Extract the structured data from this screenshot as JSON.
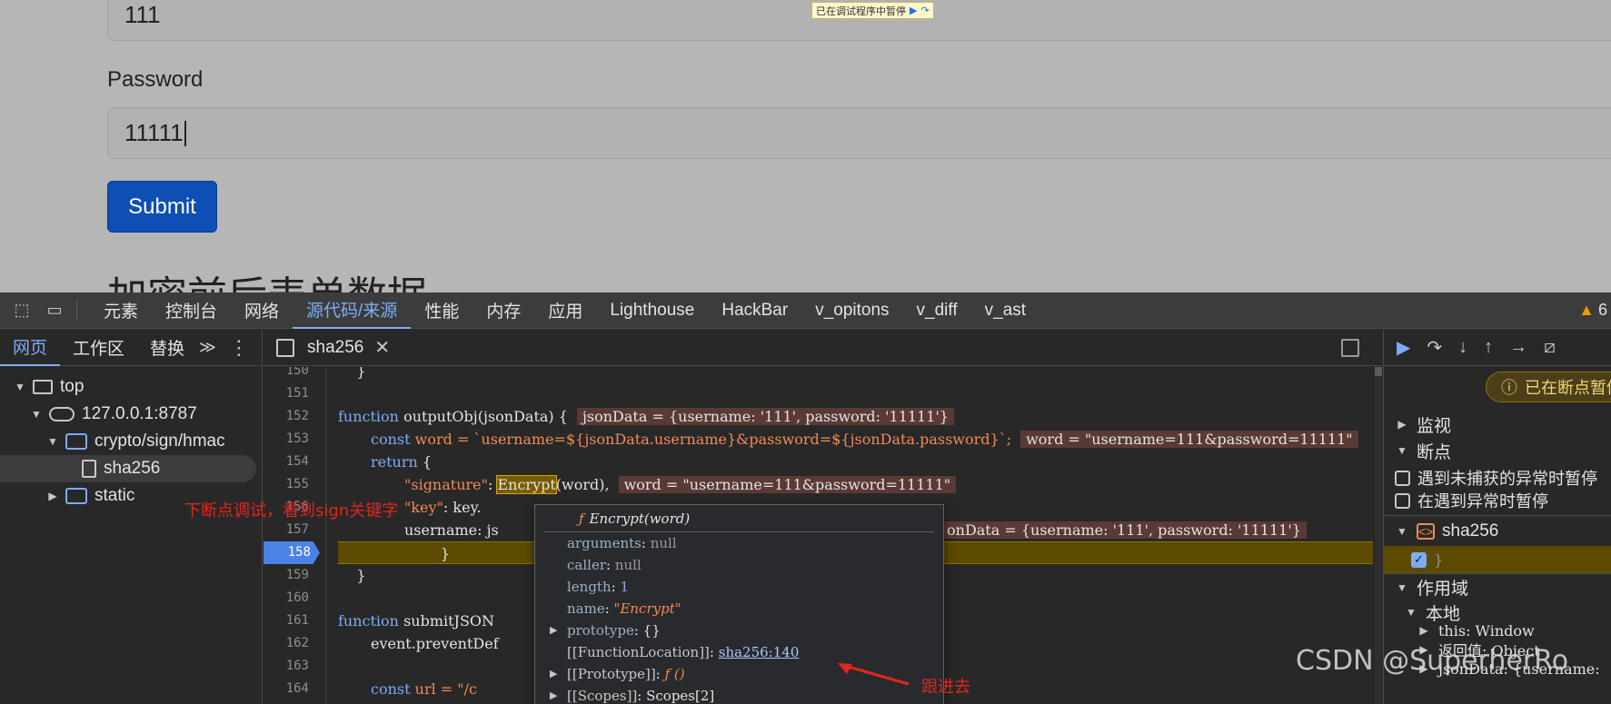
{
  "page": {
    "username_value": "111",
    "password_label": "Password",
    "password_value": "11111",
    "submit_label": "Submit",
    "heading_partial": "加密前后表单数据",
    "paused_banner": "已在调试程序中暂停"
  },
  "devtools": {
    "main_tabs": [
      "元素",
      "控制台",
      "网络",
      "源代码/来源",
      "性能",
      "内存",
      "应用",
      "Lighthouse",
      "HackBar",
      "v_opitons",
      "v_diff",
      "v_ast"
    ],
    "active_tab": "源代码/来源",
    "warning_count": "6",
    "navigator": {
      "tabs": [
        "网页",
        "工作区",
        "替换"
      ],
      "tree": [
        "top",
        "127.0.0.1:8787",
        "crypto/sign/hmac",
        "sha256",
        "static"
      ]
    },
    "editor": {
      "file_tab": "sha256",
      "lines": [
        {
          "n": "150",
          "text": "    }"
        },
        {
          "n": "151",
          "text": ""
        },
        {
          "n": "152",
          "kw": "function",
          "text": " outputObj(jsonData) {",
          "val": "jsonData = {username: '111', password: '11111'}"
        },
        {
          "n": "153",
          "kw": "const",
          "text": " word = `username=${jsonData.username}&password=${jsonData.password}`;",
          "val": "word = \"username=111&password=11111\""
        },
        {
          "n": "154",
          "kw": "return",
          "text": " {"
        },
        {
          "n": "155",
          "key": "\"signature\"",
          "fn": "Encrypt",
          "rest": "(word),",
          "val": "word = \"username=111&password=11111\""
        },
        {
          "n": "156",
          "key": "\"key\"",
          "rest": ": key."
        },
        {
          "n": "157",
          "rest": "username: js",
          "val": "onData = {username: '111', password: '11111'}"
        },
        {
          "n": "158",
          "text": "        }"
        },
        {
          "n": "159",
          "text": "    }"
        },
        {
          "n": "160",
          "text": ""
        },
        {
          "n": "161",
          "kw": "function",
          "text": " submitJSON"
        },
        {
          "n": "162",
          "text": "event.preventDef"
        },
        {
          "n": "163",
          "text": ""
        },
        {
          "n": "164",
          "kw": "const",
          "text": " url = \"/c"
        }
      ]
    },
    "popover": {
      "title_f": "ƒ",
      "title": "Encrypt(word)",
      "rows": [
        {
          "k": "arguments",
          "v": "null"
        },
        {
          "k": "caller",
          "v": "null"
        },
        {
          "k": "length",
          "v": "1"
        },
        {
          "k": "name",
          "v": "\"Encrypt\""
        },
        {
          "k": "prototype",
          "v": "{}"
        },
        {
          "k": "[[FunctionLocation]]",
          "v": "sha256:140"
        },
        {
          "k": "[[Prototype]]",
          "v": "ƒ ()"
        },
        {
          "k": "[[Scopes]]",
          "v": "Scopes[2]"
        }
      ]
    },
    "debugger": {
      "paused_label": "已在断点暂停",
      "watch": "监视",
      "breakpoints": "断点",
      "pause_uncaught": "遇到未捕获的异常时暂停",
      "pause_caught": "在遇到异常时暂停",
      "bp_file": "sha256",
      "bp_line_text": "}",
      "scope": "作用域",
      "local": "本地",
      "this_row": "this: Window",
      "return_row": "返回值: Object",
      "json_row": "jsonData: {username:"
    }
  },
  "annotations": {
    "note1": "下断点调试，看到sign关键字",
    "note2": "跟进去"
  },
  "watermark": "CSDN @SuperherRo"
}
